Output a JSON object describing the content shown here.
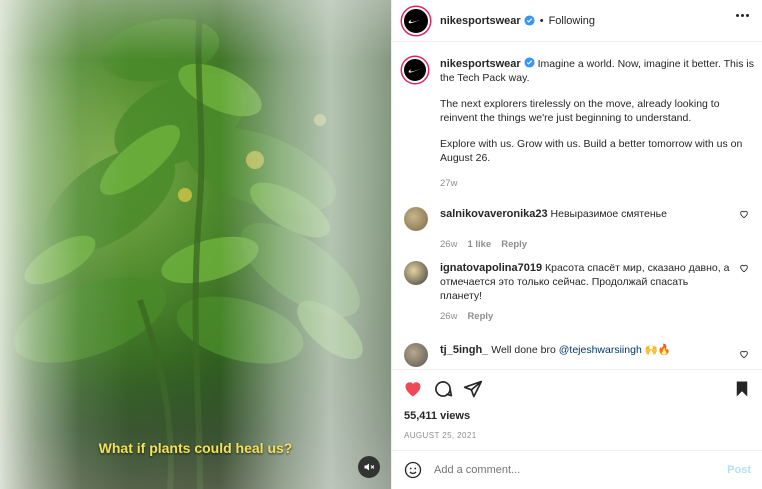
{
  "media": {
    "subtitle": "What if plants could heal us?",
    "mute_icon": "speaker-muted-icon"
  },
  "header": {
    "username": "nikesportswear",
    "separator": "•",
    "follow_status": "Following",
    "more_icon": "more-horizontal-icon"
  },
  "caption": {
    "username": "nikesportswear",
    "text_1": "Imagine a world. Now, imagine it better. This is the Tech Pack way.",
    "text_2": "The next explorers tirelessly on the move, already looking to reinvent the things we're just beginning to understand.",
    "text_3": "Explore with us. Grow with us. Build a better tomorrow with us on August 26.",
    "ago": "27w"
  },
  "comments": [
    {
      "username": "salnikovaveronika23",
      "text": "Невыразимое смятенье",
      "ago": "26w",
      "likes": "1 like",
      "reply": "Reply"
    },
    {
      "username": "ignatovapolina7019",
      "text": "Красота спасёт мир, сказано давно, а отмечается это только сейчас. Продолжай спасать планету!",
      "ago": "26w",
      "reply": "Reply"
    },
    {
      "username": "tj_5ingh_",
      "text": "Well done bro",
      "mention": "@tejeshwarsiingh",
      "emoji": "🙌🔥"
    }
  ],
  "actions": {
    "views": "55,411 views",
    "date": "AUGUST 25, 2021",
    "like_color": "#ed4956"
  },
  "add_comment": {
    "placeholder": "Add a comment...",
    "post_label": "Post"
  },
  "colors": {
    "verified": "#3897f0",
    "subtitle": "#f2e35a",
    "post_disabled": "#b2dffc"
  }
}
